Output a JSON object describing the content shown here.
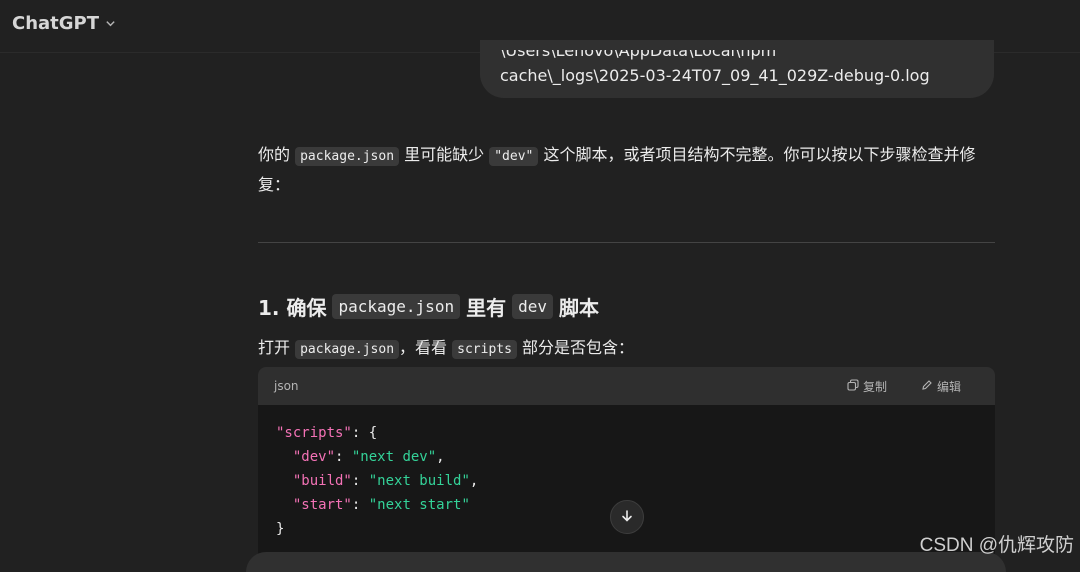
{
  "header": {
    "title": "ChatGPT",
    "chevron_icon": "chevron-down-icon"
  },
  "user_message": {
    "line1": "\\Users\\Lenovo\\AppData\\Local\\npm",
    "line2": "cache\\_logs\\2025-03-24T07_09_41_029Z-debug-0.log"
  },
  "assistant": {
    "para1": {
      "t1": "你的",
      "c1": "package.json",
      "t2": "里可能缺少",
      "c2": "\"dev\"",
      "t3": "这个脚本，或者项目结构不完整。你可以按以下步骤检查并修复："
    },
    "section1": {
      "heading_pre": "1. 确保",
      "heading_code1": "package.json",
      "heading_mid": "里有",
      "heading_code2": "dev",
      "heading_post": "脚本",
      "p_t1": "打开",
      "p_c1": "package.json",
      "p_t2": "，看看",
      "p_c2": "scripts",
      "p_t3": "部分是否包含："
    },
    "codeblock": {
      "lang": "json",
      "copy_label": "复制",
      "edit_label": "编辑",
      "lines": {
        "l1_key": "\"scripts\"",
        "l1_rest": ": {",
        "l2_key": "\"dev\"",
        "l2_val": "\"next dev\"",
        "l3_key": "\"build\"",
        "l3_val": "\"next build\"",
        "l4_key": "\"start\"",
        "l4_val": "\"next start\"",
        "l5": "}"
      }
    }
  },
  "watermark": "CSDN @仇辉攻防"
}
